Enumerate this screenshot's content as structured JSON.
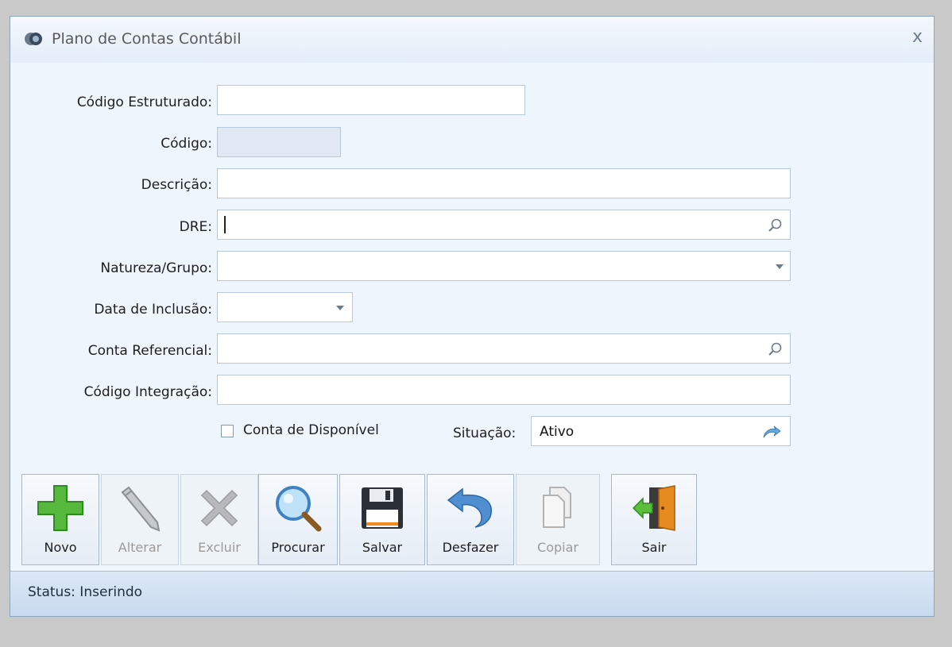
{
  "window": {
    "title": "Plano de Contas Contábil",
    "close_symbol": "x"
  },
  "form": {
    "codigo_estruturado": {
      "label": "Código Estruturado:",
      "value": ""
    },
    "codigo": {
      "label": "Código:",
      "value": ""
    },
    "descricao": {
      "label": "Descrição:",
      "value": ""
    },
    "dre": {
      "label": "DRE:",
      "value": "",
      "icon": "search-icon"
    },
    "natureza_grupo": {
      "label": "Natureza/Grupo:",
      "value": ""
    },
    "data_inclusao": {
      "label": "Data de Inclusão:",
      "value": ""
    },
    "conta_referencial": {
      "label": "Conta Referencial:",
      "value": "",
      "icon": "search-icon"
    },
    "codigo_integracao": {
      "label": "Código Integração:",
      "value": ""
    },
    "conta_disponivel": {
      "label": "Conta de Disponível",
      "checked": false
    },
    "situacao": {
      "label": "Situação:",
      "value": "Ativo",
      "icon": "redo-arrow-icon"
    }
  },
  "toolbar": {
    "novo": {
      "label": "Novo",
      "icon": "plus-icon",
      "enabled": true
    },
    "alterar": {
      "label": "Alterar",
      "icon": "pencil-icon",
      "enabled": false
    },
    "excluir": {
      "label": "Excluir",
      "icon": "x-icon",
      "enabled": false
    },
    "procurar": {
      "label": "Procurar",
      "icon": "magnifier-icon",
      "enabled": true
    },
    "salvar": {
      "label": "Salvar",
      "icon": "floppy-disk-icon",
      "enabled": true
    },
    "desfazer": {
      "label": "Desfazer",
      "icon": "undo-arrow-icon",
      "enabled": true
    },
    "copiar": {
      "label": "Copiar",
      "icon": "copy-icon",
      "enabled": false
    },
    "sair": {
      "label": "Sair",
      "icon": "exit-door-icon",
      "enabled": true
    }
  },
  "status": {
    "text": "Status: Inserindo"
  },
  "colors": {
    "accent": "#4c9ad5",
    "novo_green": "#4fb23a",
    "disabled_gray": "#9a9a9a"
  }
}
